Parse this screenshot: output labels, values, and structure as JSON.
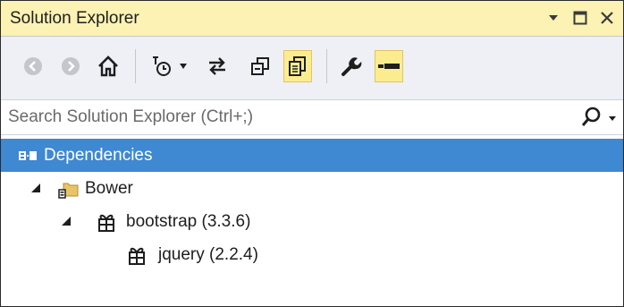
{
  "window": {
    "title": "Solution Explorer",
    "controls": {
      "dropdown_icon": "chevron-down-icon",
      "maximize_icon": "maximize-icon",
      "close_icon": "close-icon"
    }
  },
  "toolbar": {
    "tools": [
      {
        "name": "back",
        "icon": "back-arrow-icon"
      },
      {
        "name": "forward",
        "icon": "forward-arrow-icon"
      },
      {
        "name": "home",
        "icon": "home-icon"
      },
      {
        "name": "pending-changes-filter",
        "icon": "clock-filter-icon"
      },
      {
        "name": "pending-changes-dropdown",
        "icon": "chevron-down-icon"
      },
      {
        "name": "sync-with-active-document",
        "icon": "sync-arrows-icon"
      },
      {
        "name": "collapse-all",
        "icon": "collapse-all-icon"
      },
      {
        "name": "show-all-files",
        "icon": "show-all-files-icon",
        "active": true
      },
      {
        "name": "properties",
        "icon": "wrench-icon"
      },
      {
        "name": "preview-selected-items",
        "icon": "preview-icon",
        "active": true
      }
    ]
  },
  "search": {
    "placeholder": "Search Solution Explorer (Ctrl+;)",
    "value": "",
    "icon": "search-icon"
  },
  "tree": {
    "nodes": [
      {
        "label": "Dependencies",
        "icon": "dependencies-icon",
        "depth": 0,
        "selected": true,
        "expander": "none"
      },
      {
        "label": "Bower",
        "icon": "bower-folder-icon",
        "depth": 1,
        "selected": false,
        "expander": "expanded"
      },
      {
        "label": "bootstrap (3.3.6)",
        "icon": "package-icon",
        "depth": 2,
        "selected": false,
        "expander": "expanded"
      },
      {
        "label": "jquery (2.2.4)",
        "icon": "package-icon",
        "depth": 3,
        "selected": false,
        "expander": "none"
      }
    ]
  },
  "colors": {
    "title_bar": "#fbf2b3",
    "toolbar_bg": "#eef0f5",
    "active_tool": "#fbed8f",
    "selection": "#3f88d2",
    "text": "#1e1e1e"
  }
}
